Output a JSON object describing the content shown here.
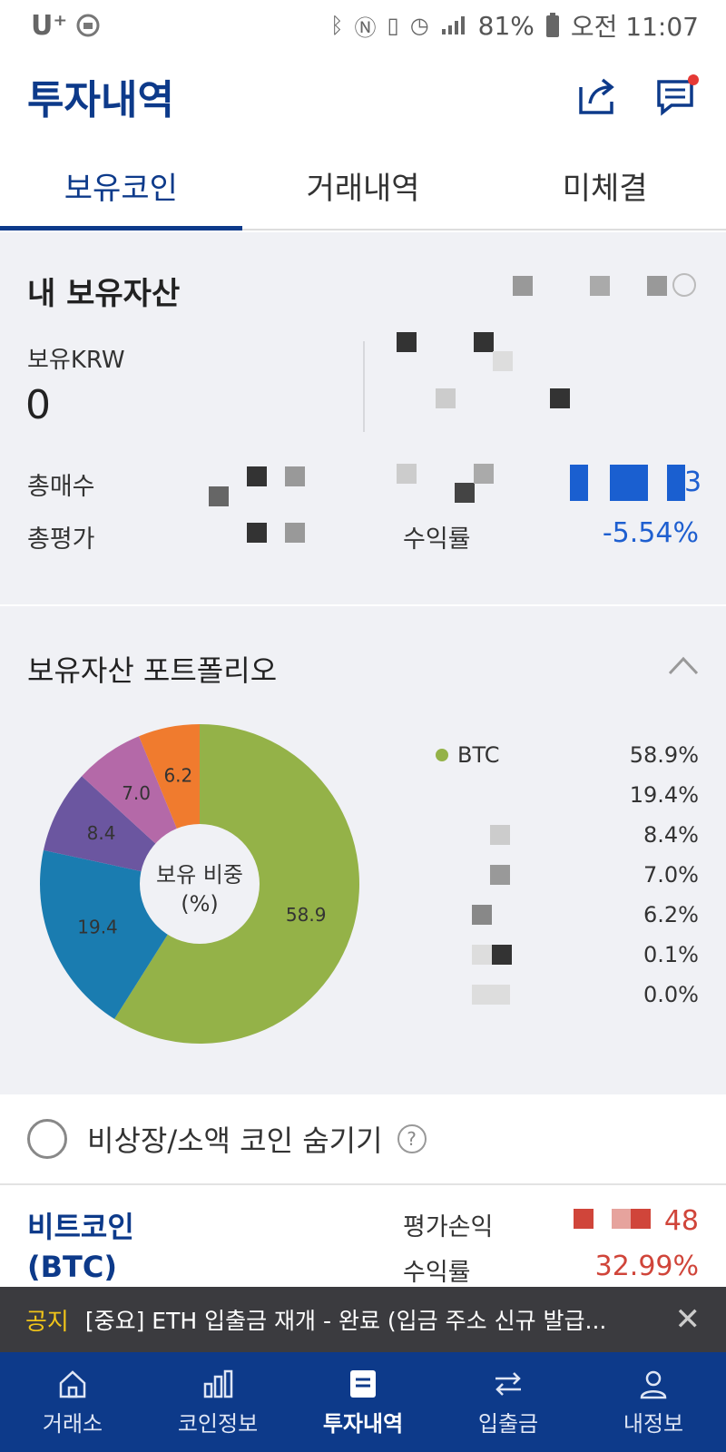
{
  "status_bar": {
    "carrier": "U⁺",
    "battery": "81%",
    "time": "오전 11:07"
  },
  "header": {
    "title": "투자내역",
    "share_icon": "share-icon",
    "chat_icon": "chat-icon",
    "badge_color": "#e53935"
  },
  "tabs": [
    {
      "label": "보유코인",
      "active": true
    },
    {
      "label": "거래내역",
      "active": false
    },
    {
      "label": "미체결",
      "active": false
    }
  ],
  "summary": {
    "title": "내 보유자산",
    "krw_label": "보유KRW",
    "krw_value": "0",
    "total_buy_label": "총매수",
    "total_eval_label": "총평가",
    "profit_rate_label": "수익률",
    "profit_rate_value": "-5.54%",
    "profit_rate_suffix": "3"
  },
  "portfolio": {
    "title": "보유자산 포트폴리오",
    "center_label": "보유 비중",
    "center_unit": "(%)",
    "legend": [
      {
        "name": "BTC",
        "pct": "58.9%"
      },
      {
        "name": "",
        "pct": "19.4%"
      },
      {
        "name": "",
        "pct": "8.4%"
      },
      {
        "name": "",
        "pct": "7.0%"
      },
      {
        "name": "",
        "pct": "6.2%"
      },
      {
        "name": "",
        "pct": "0.1%"
      },
      {
        "name": "",
        "pct": "0.0%"
      }
    ]
  },
  "chart_data": {
    "type": "pie",
    "donut": true,
    "values": [
      58.9,
      19.4,
      8.4,
      7.0,
      6.2
    ],
    "labels": [
      "58.9",
      "19.4",
      "8.4",
      "7.0",
      "6.2"
    ],
    "colors": [
      "#94b248",
      "#1a7cb0",
      "#6b56a0",
      "#b469a8",
      "#f07b2e"
    ],
    "title": ""
  },
  "hide_row": {
    "label": "비상장/소액 코인 숨기기",
    "help": "?"
  },
  "coin": {
    "name": "비트코인",
    "ticker": "(BTC)",
    "eval_pl_label": "평가손익",
    "eval_pl_suffix": "48",
    "rate_label": "수익률",
    "rate_value": "32.99%"
  },
  "notice": {
    "tag": "공지",
    "message": "[중요] ETH 입출금 재개 - 완료 (입금 주소 신규 발급...",
    "close": "✕"
  },
  "bottom_nav": [
    {
      "label": "거래소",
      "icon": "home-icon",
      "active": false
    },
    {
      "label": "코인정보",
      "icon": "bar-chart-icon",
      "active": false
    },
    {
      "label": "투자내역",
      "icon": "document-icon",
      "active": true
    },
    {
      "label": "입출금",
      "icon": "transfer-icon",
      "active": false
    },
    {
      "label": "내정보",
      "icon": "person-icon",
      "active": false
    }
  ]
}
